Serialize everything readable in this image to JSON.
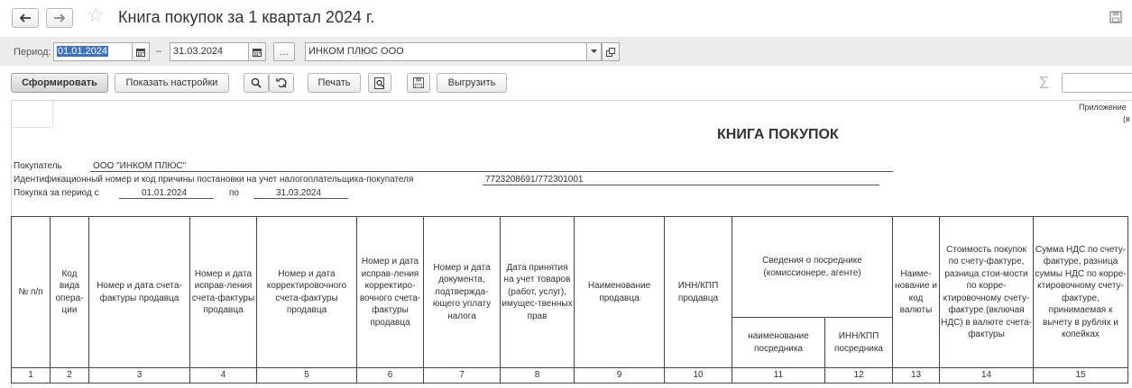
{
  "window": {
    "title": "Книга покупок за 1 квартал 2024 г."
  },
  "period_panel": {
    "period_label": "Период:",
    "date_from": "01.01.2024",
    "dash": "–",
    "date_to": "31.03.2024",
    "more_button": "...",
    "organization": "ИНКОМ ПЛЮС ООО"
  },
  "toolbar": {
    "generate": "Сформировать",
    "show_settings": "Показать настройки",
    "print": "Печать",
    "export": "Выгрузить",
    "sum_symbol": "Σ"
  },
  "report": {
    "appendix_line1": "Приложение",
    "appendix_line2": "(в",
    "title": "КНИГА ПОКУПОК",
    "buyer_label": "Покупатель",
    "buyer_value": "ООО \"ИНКОМ ПЛЮС\"",
    "inn_label": "Идентификационный номер и код причины постановки на учет налогоплательщика-покупателя",
    "inn_value": "7723208691/772301001",
    "period_label": "Покупка за период с",
    "period_from": "01.01.2024",
    "period_to_label": "по",
    "period_to": "31.03.2024"
  },
  "table": {
    "headers": {
      "c1": "№ п/п",
      "c2": "Код вида опера-ции",
      "c3": "Номер и дата счета-фактуры продавца",
      "c4": "Номер и дата исправ-ления счета-фактуры продавца",
      "c5": "Номер и дата корректировочного счета-фактуры продавца",
      "c6": "Номер и дата исправ-ления корректиро-вочного счета-фактуры продавца",
      "c7": "Номер и дата документа, подтвержда-ющего уплату налога",
      "c8": "Дата принятия на учет товаров (работ, услуг), имущес-твенных прав",
      "c9": "Наименование продавца",
      "c10": "ИНН/КПП продавца",
      "c11_12": "Сведения о посреднике (комиссионере, агенте)",
      "c11": "наименование посредника",
      "c12": "ИНН/КПП посредника",
      "c13": "Наиме-нование и код валюты",
      "c14": "Стоимость покупок по счету-фактуре, разница стои-мости по корре-ктировочному счету-фактуре (включая НДС) в валюте счета-фактуры",
      "c15": "Сумма НДС по счету-фактуре, разница суммы НДС по корре-ктировочному счету-фактуре, принимаемая к вычету в рублях и копейках"
    },
    "numbers": [
      "1",
      "2",
      "3",
      "4",
      "5",
      "6",
      "7",
      "8",
      "9",
      "10",
      "11",
      "12",
      "13",
      "14",
      "15"
    ]
  }
}
